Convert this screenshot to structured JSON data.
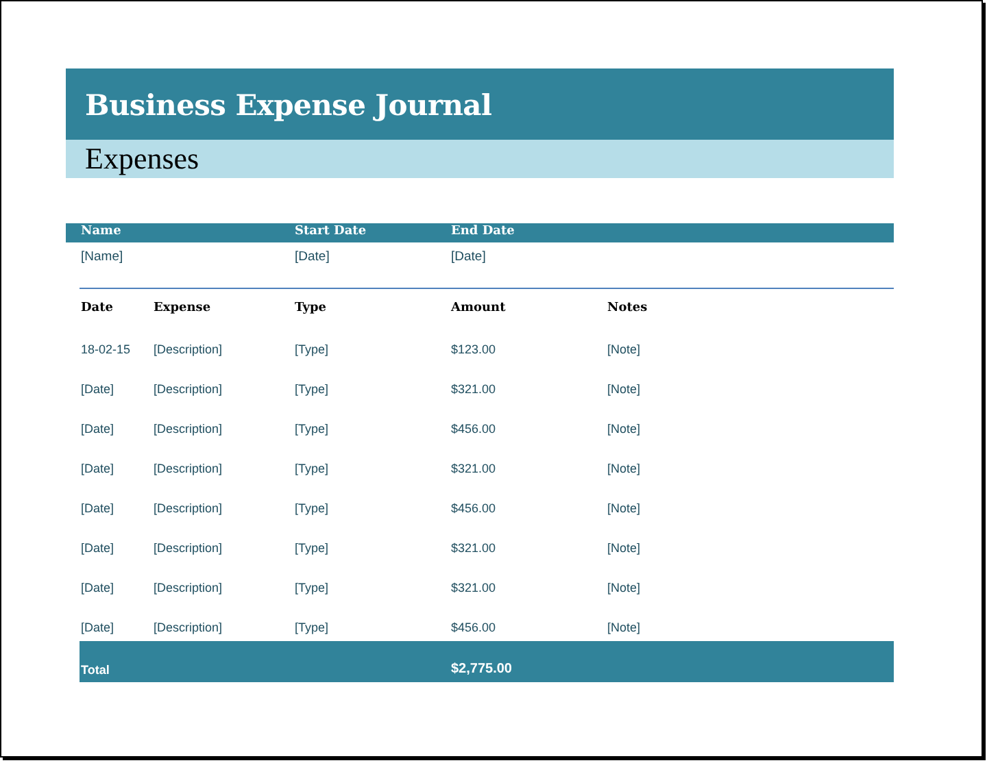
{
  "title": "Business Expense Journal",
  "subtitle": "Expenses",
  "info": {
    "columns": [
      "Name",
      "Start Date",
      "End Date"
    ],
    "values": [
      "[Name]",
      "[Date]",
      "[Date]"
    ]
  },
  "table": {
    "columns": [
      "Date",
      "Expense",
      "Type",
      "Amount",
      "Notes"
    ],
    "rows": [
      [
        "18-02-15",
        "[Description]",
        "[Type]",
        "$123.00",
        "[Note]"
      ],
      [
        "[Date]",
        "[Description]",
        "[Type]",
        "$321.00",
        "[Note]"
      ],
      [
        "[Date]",
        "[Description]",
        "[Type]",
        "$456.00",
        "[Note]"
      ],
      [
        "[Date]",
        "[Description]",
        "[Type]",
        "$321.00",
        "[Note]"
      ],
      [
        "[Date]",
        "[Description]",
        "[Type]",
        "$456.00",
        "[Note]"
      ],
      [
        "[Date]",
        "[Description]",
        "[Type]",
        "$321.00",
        "[Note]"
      ],
      [
        "[Date]",
        "[Description]",
        "[Type]",
        "$321.00",
        "[Note]"
      ],
      [
        "[Date]",
        "[Description]",
        "[Type]",
        "$456.00",
        "[Note]"
      ]
    ],
    "total": {
      "label": "Total",
      "amount": "$2,775.00"
    }
  }
}
